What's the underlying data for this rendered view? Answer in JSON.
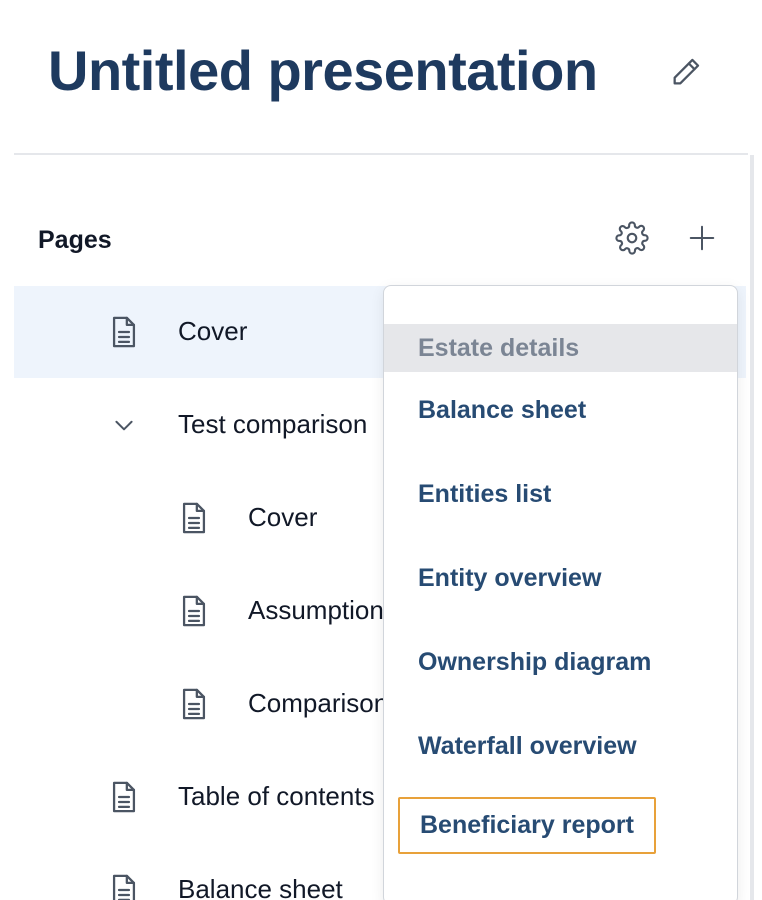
{
  "presentation": {
    "title": "Untitled presentation"
  },
  "pages_panel": {
    "label": "Pages",
    "tree": [
      {
        "label": "Cover",
        "icon": "document-icon"
      },
      {
        "label": "Test comparison",
        "icon": "chevron-down-icon"
      },
      {
        "label": "Cover",
        "icon": "document-icon"
      },
      {
        "label": "Assumptions",
        "icon": "document-icon"
      },
      {
        "label": "Comparison",
        "icon": "document-icon"
      },
      {
        "label": "Table of contents",
        "icon": "document-icon"
      },
      {
        "label": "Balance sheet",
        "icon": "document-icon"
      }
    ]
  },
  "menu": {
    "header": "Estate details",
    "items": [
      "Balance sheet",
      "Entities list",
      "Entity overview",
      "Ownership diagram",
      "Waterfall overview",
      "Beneficiary report"
    ]
  },
  "colors": {
    "title": "#1e3a5f",
    "active_row": "#eef4fc",
    "menu_item": "#274b73",
    "focus_outline": "#e8a13a"
  }
}
